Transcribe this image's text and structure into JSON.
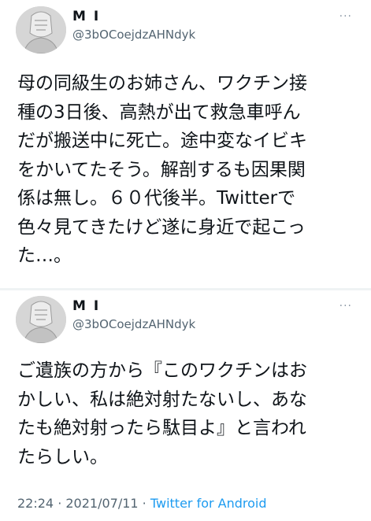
{
  "tweets": [
    {
      "name": "M I",
      "handle": "@3bOCoejdzAHNdyk",
      "more": "···",
      "text": "母の同級生のお姉さん、ワクチン接\n種の3日後、高熱が出て救急車呼ん\nだが搬送中に死亡。途中変なイビキ\nをかいてたそう。解剖するも因果関\n係は無し。６０代後半。Twitterで\n色々見てきたけど遂に身近で起こっ\nた…。"
    },
    {
      "name": "M I",
      "handle": "@3bOCoejdzAHNdyk",
      "more": "···",
      "text": "ご遺族の方から『このワクチンはお\nかしい、私は絶対射たないし、あな\nたも絶対射ったら駄目よ』と言われ\nたらしい。"
    }
  ],
  "meta": {
    "time": "22:24",
    "sep1": " · ",
    "date": "2021/07/11",
    "sep2": " · ",
    "app": "Twitter for Android"
  },
  "colors": {
    "text": "#0f1419",
    "secondary": "#536471",
    "link": "#1d9bf0",
    "divider": "#eff3f4"
  },
  "icons": {
    "avatar": "avatar-icon",
    "more": "more-options-icon"
  }
}
